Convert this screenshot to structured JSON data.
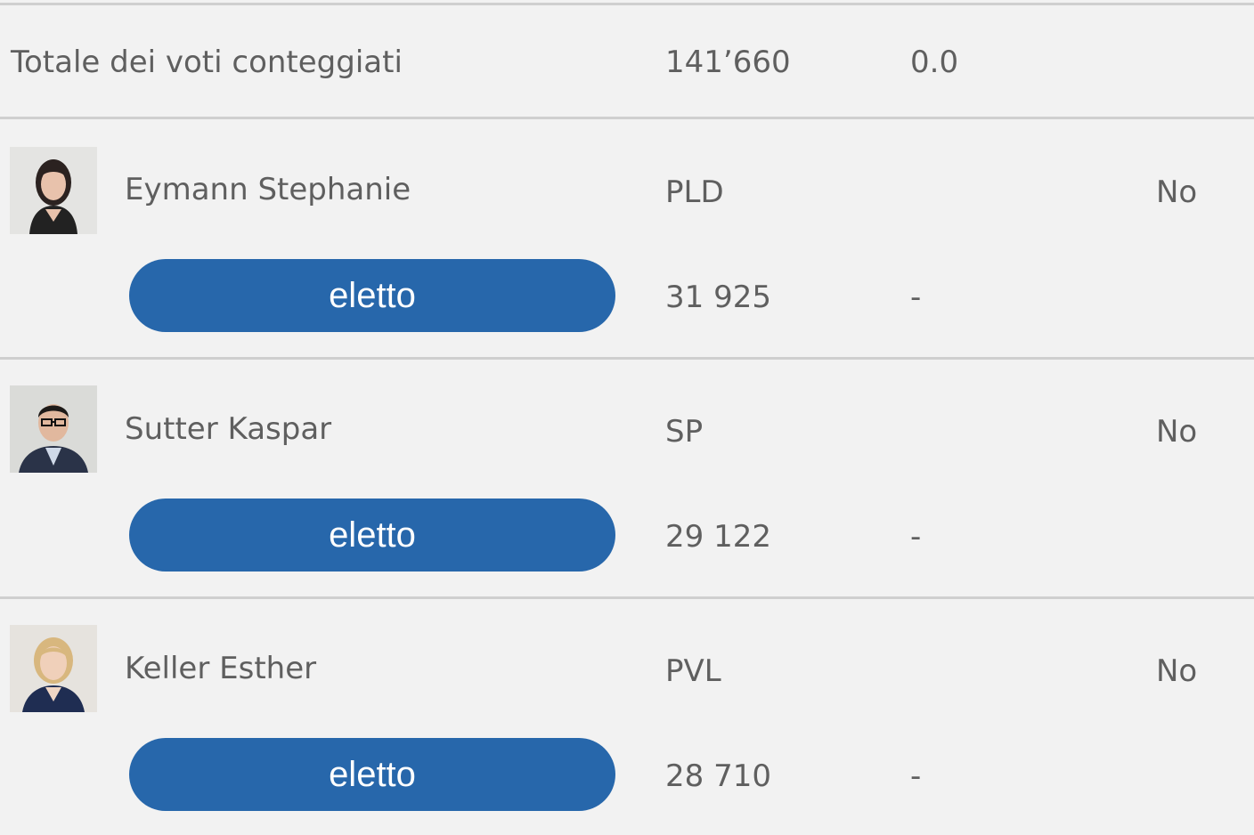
{
  "summary": {
    "label": "Totale dei voti conteggiati",
    "votes": "141’660",
    "percent": "0.0"
  },
  "candidates": [
    {
      "name": "Eymann Stephanie",
      "party": "PLD",
      "flag": "No",
      "status": "eletto",
      "votes": "31 925",
      "diff": "-",
      "photo_icon": "woman-portrait-icon"
    },
    {
      "name": "Sutter Kaspar",
      "party": "SP",
      "flag": "No",
      "status": "eletto",
      "votes": "29 122",
      "diff": "-",
      "photo_icon": "man-portrait-icon"
    },
    {
      "name": "Keller Esther",
      "party": "PVL",
      "flag": "No",
      "status": "eletto",
      "votes": "28 710",
      "diff": "-",
      "photo_icon": "woman-portrait-icon"
    }
  ],
  "colors": {
    "accent": "#2767ab",
    "background": "#f2f2f2",
    "divider": "#cfcfcf",
    "text": "#5f5f5f"
  }
}
